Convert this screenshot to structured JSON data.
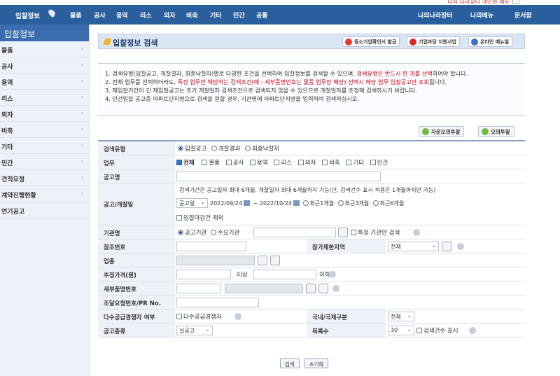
{
  "topstrip": {
    "text": "나의 나라장터 개인화 메뉴"
  },
  "nav": {
    "left_items": [
      "입찰정보",
      "물품",
      "공사",
      "용역",
      "리스",
      "외자",
      "비축",
      "기타",
      "민간",
      "공통"
    ],
    "right_items": [
      "나의나라장터",
      "나의메뉴",
      "문서함"
    ]
  },
  "sidebar": {
    "header": "입찰정보",
    "items": [
      {
        "label": "물품",
        "arrow": "›"
      },
      {
        "label": "공사",
        "arrow": "›"
      },
      {
        "label": "용역",
        "arrow": "›"
      },
      {
        "label": "리스",
        "arrow": "›"
      },
      {
        "label": "외자",
        "arrow": "›"
      },
      {
        "label": "비축",
        "arrow": "›"
      },
      {
        "label": "기타",
        "arrow": "›"
      },
      {
        "label": "민간",
        "arrow": "›"
      },
      {
        "label": "견적요청",
        "arrow": "›"
      },
      {
        "label": "계약진행현황",
        "arrow": "›"
      },
      {
        "label": "연기공고",
        "arrow": ""
      }
    ]
  },
  "title": "입찰정보 검색",
  "title_buttons": [
    {
      "label": "중소기업확인서 발급",
      "color": "#e23b2a"
    },
    {
      "label": "기업마당 지원사업",
      "color": "#d8292f"
    },
    {
      "label": "온라인 매뉴얼",
      "color": "#3a74c9"
    }
  ],
  "notice": {
    "line1_a": "1. 검색유형(입찰공고, 개찰결과, 최종낙찰자)별로 다양한 조건을 선택하여 입찰정보를 검색할 수 있으며, ",
    "line1_red": "검색유형은 반드시 한 개를 선택",
    "line1_b": "하여야 합니다.",
    "line2_a": "2. 전체 업무를 선택하더라도, ",
    "line2_red": "특정 업무만 해당하는 검색조건(예 : 세부품명번호는 물품 업무만 해당) 선택시 해당 업무 입찰공고만 조회",
    "line2_b": "됩니다.",
    "line3": "3. 재입찰기간이 긴 재입찰공고는 초기 개찰일자 검색조건으로 검색되지 않을 수 있으므로 개찰일자를 조정해 검색하시기 바랍니다.",
    "line4": "4. 민간입찰 공고중 아파트단지명으로 검색을 원할 경우, 기관명에 아파트단지명을 입력하여 검색하십시오."
  },
  "action_buttons": {
    "mock_own": "자문모의투찰",
    "mock": "모의투찰"
  },
  "form": {
    "search_type": {
      "label": "검색유형",
      "options": [
        "입찰공고",
        "개찰결과",
        "최종낙찰자"
      ],
      "selected": "입찰공고"
    },
    "business": {
      "label": "업무",
      "all": "전체",
      "options": [
        "물품",
        "공사",
        "용역",
        "리스",
        "외자",
        "비축",
        "기타",
        "민간"
      ]
    },
    "notice_name": {
      "label": "공고명"
    },
    "period": {
      "label": "공고/개찰일",
      "hint": "검색기간은 공고일자 최대 6개월, 개찰일자 최대 6개월까지 가능(단, 검색건수 표시 적용은 1개월까지만 가능)",
      "date_type": "공고일",
      "from": "2022/09/24",
      "tilde": "~",
      "to": "2022/10/24",
      "quick": [
        "최근1개월",
        "최근3개월",
        "최근6개월"
      ],
      "exclude_closed": "입찰마감건 제외"
    },
    "agency": {
      "label": "기관명",
      "options": [
        "공고기관",
        "수요기관"
      ],
      "specific": "특정 기관만 검색"
    },
    "ref_no": {
      "label": "참조번호",
      "region_label": "참가제한지역",
      "region_value": "전체"
    },
    "industry": {
      "label": "업종"
    },
    "price": {
      "label": "추정가격(원)",
      "above": "이상",
      "below": "이하"
    },
    "detail_item": {
      "label": "세부품명번호"
    },
    "procurement": {
      "label": "조달요청번호/PR No."
    },
    "multi_supplier": {
      "label": "다수공급경쟁자 여부",
      "check": "다수공급경쟁자",
      "intl_label": "국내/국제구분",
      "intl_value": "전체"
    },
    "notice_kind": {
      "label": "공고종류",
      "value": "실공고",
      "count_label": "목록수",
      "count_value": "30",
      "show_count": "검색건수 표시"
    }
  },
  "bottom_buttons": {
    "search": "검색",
    "reset": "초기화"
  }
}
